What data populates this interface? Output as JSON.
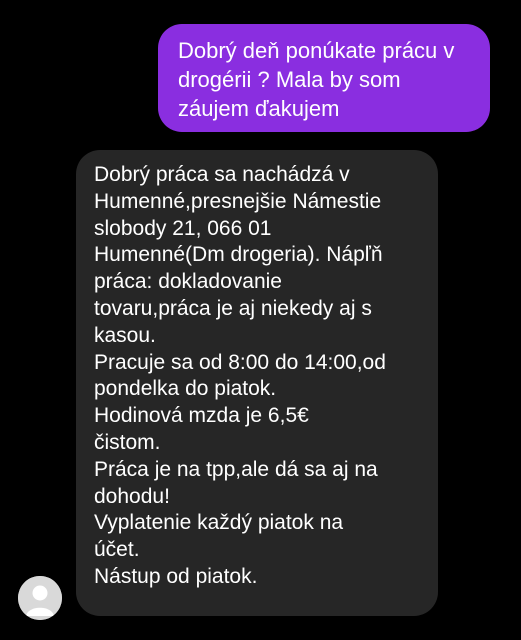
{
  "conversation": {
    "outgoing": {
      "text": "Dobrý deň ponúkate prácu v\ndrogérii ? Mala by som\nzáujem ďakujem"
    },
    "incoming": {
      "text": "Dobrý práca sa nachádzá v\nHumenné,presnejšie Námestie\nslobody 21, 066 01\nHumenné(Dm drogeria). Nápľň\npráca: dokladovanie\ntovaru,práca je aj niekedy aj s\nkasou.\nPracuje sa od 8:00 do 14:00,od\npondelka do piatok.\nHodinová mzda je 6,5€\n čistom.\nPráca je na tpp,ale dá sa aj na\ndohodu!\nVyplatenie každý piatok na\núčet.\nNástup od piatok.",
      "avatar_icon": "person-icon"
    }
  },
  "colors": {
    "background": "#000000",
    "outgoing_bubble": "#8a2ee0",
    "incoming_bubble": "#262626",
    "avatar": "#d9d9d9"
  }
}
